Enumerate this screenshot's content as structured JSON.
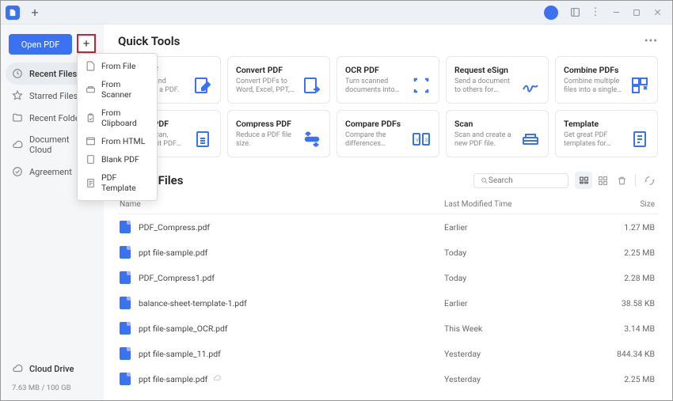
{
  "titlebar": {
    "new_tab": "+"
  },
  "sidebar": {
    "open_label": "Open PDF",
    "items": [
      {
        "icon": "clock",
        "label": "Recent Files",
        "active": true
      },
      {
        "icon": "star",
        "label": "Starred Files"
      },
      {
        "icon": "folder",
        "label": "Recent Folders"
      },
      {
        "icon": "cloud",
        "label": "Document Cloud"
      },
      {
        "icon": "check",
        "label": "Agreement"
      }
    ],
    "cloud": {
      "label": "Cloud Drive",
      "storage": "7.63 MB / 100 GB"
    }
  },
  "plus_menu": [
    {
      "icon": "file",
      "label": "From File"
    },
    {
      "icon": "scanner",
      "label": "From Scanner"
    },
    {
      "icon": "clipboard",
      "label": "From Clipboard"
    },
    {
      "icon": "html",
      "label": "From HTML"
    },
    {
      "icon": "blank",
      "label": "Blank PDF"
    },
    {
      "icon": "template",
      "label": "PDF Template"
    }
  ],
  "quick_tools": {
    "title": "Quick Tools",
    "cards": [
      {
        "title": "Edit PDF",
        "desc": "Edit text and images in a PDF.",
        "icon": "edit",
        "covered": true
      },
      {
        "title": "Convert PDF",
        "desc": "Convert PDFs to Word, Excel, PPT, etc.",
        "icon": "convert"
      },
      {
        "title": "OCR PDF",
        "desc": "Turn scanned documents into searchable or editable ...",
        "icon": "ocr"
      },
      {
        "title": "Request eSign",
        "desc": "Send a document to others for signing.",
        "icon": "esign"
      },
      {
        "title": "Combine PDFs",
        "desc": "Combine multiple files into a single PDF.",
        "icon": "combine"
      },
      {
        "title": "Create PDF",
        "desc": "Quickly scan, create, edit PDF files.",
        "icon": "create",
        "covered": true
      },
      {
        "title": "Compress PDF",
        "desc": "Reduce a PDF file size.",
        "icon": "compress"
      },
      {
        "title": "Compare PDFs",
        "desc": "Compare the differences between two files.",
        "icon": "compare"
      },
      {
        "title": "Scan",
        "desc": "Scan and create a new PDF file.",
        "icon": "scan"
      },
      {
        "title": "Template",
        "desc": "Get great PDF templates for resumes, posters, etc.",
        "icon": "template"
      }
    ]
  },
  "recent_files": {
    "title": "Recent Files",
    "search_placeholder": "Search",
    "cols": {
      "name": "Name",
      "time": "Last Modified Time",
      "size": "Size"
    },
    "rows": [
      {
        "name": "PDF_Compress.pdf",
        "time": "Earlier",
        "size": "1.27 MB"
      },
      {
        "name": "ppt file-sample.pdf",
        "time": "Today",
        "size": "2.25 MB"
      },
      {
        "name": "PDF_Compress1.pdf",
        "time": "Today",
        "size": "2.28 MB"
      },
      {
        "name": "balance-sheet-template-1.pdf",
        "time": "Earlier",
        "size": "38.58 KB"
      },
      {
        "name": "ppt file-sample_OCR.pdf",
        "time": "This Week",
        "size": "3.14 MB"
      },
      {
        "name": "ppt file-sample_11.pdf",
        "time": "Yesterday",
        "size": "844.34 KB"
      },
      {
        "name": "ppt file-sample.pdf",
        "time": "Yesterday",
        "size": "2.25 MB",
        "cloud": true
      }
    ]
  }
}
